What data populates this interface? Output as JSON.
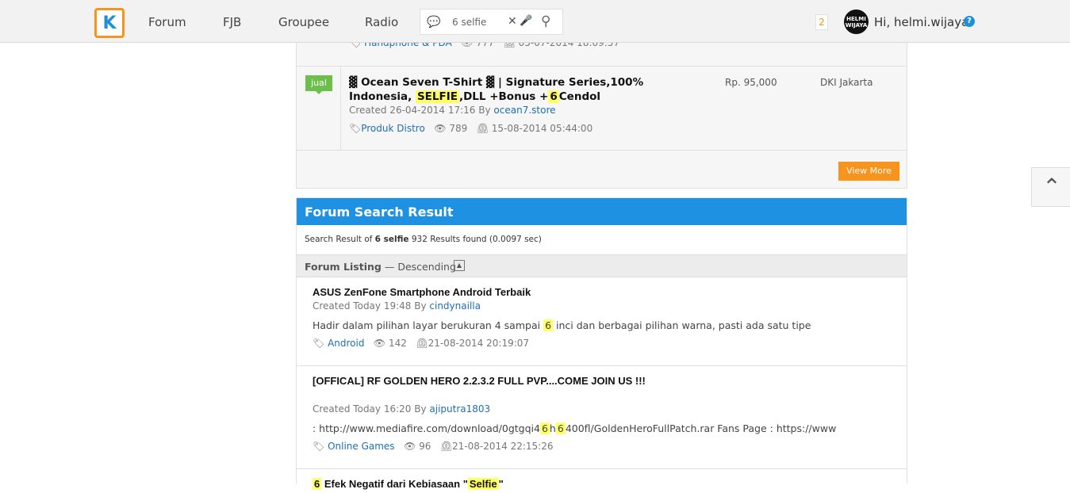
{
  "nav": {
    "logo_text": "K",
    "items": [
      "Forum",
      "FJB",
      "Groupee",
      "Radio"
    ],
    "search_value": "6 selfie",
    "notif_count": "2",
    "avatar_text": "HELMI WIJAYA",
    "greeting": "Hi, helmi.wijaya",
    "help": "?"
  },
  "fjb": {
    "prev_category": "Handphone & PDA",
    "prev_views": "777",
    "prev_date": "05-07-2014 18:09:57",
    "item": {
      "badge": "jual",
      "title_part1": "▓ Ocean Seven T-Shirt ▓ | Signature Series,100% Indonesia,",
      "title_hl1": "SELFIE",
      "title_part2": ",DLL +Bonus +",
      "title_hl2": "6",
      "title_part3": "Cendol",
      "created_prefix": "Created 26-04-2014 17:16 By",
      "author": "ocean7.store",
      "category": "Produk Distro",
      "views": "789",
      "date": "15-08-2014 05:44:00",
      "price": "Rp. 95,000",
      "location": "DKI Jakarta"
    },
    "view_more": "View More"
  },
  "results": {
    "header": "Forum Search Result",
    "summary_prefix": "Search Result of",
    "summary_query": "6 selfie",
    "summary_suffix": "932 Results found (0.0097 sec)",
    "listing_label": "Forum Listing",
    "listing_sort": "— Descending",
    "threads": [
      {
        "title": "ASUS ZenFone Smartphone Android Terbaik",
        "created_prefix": "Created Today 19:48 By",
        "author": "cindynailla",
        "snippet_a": "Hadir dalam pilihan layar berukuran 4 sampai",
        "snippet_hl": "6",
        "snippet_b": "inci dan berbagai pilihan warna, pasti ada satu tipe",
        "category": "Android",
        "views": "142",
        "date": "21-08-2014 20:19:07"
      },
      {
        "title": "[OFFICAL] RF GOLDEN HERO 2.2.3.2 FULL PVP....COME JOIN US !!!",
        "created_prefix": "Created Today 16:20 By",
        "author": "ajiputra1803",
        "snippet_a": ": http://www.mediafire.com/download/0gtgqi4",
        "snippet_hl": "6",
        "snippet_b": "h",
        "snippet_hl2": "6",
        "snippet_c": "400fl/GoldenHeroFullPatch.rar Fans Page : https://www",
        "category": "Online Games",
        "views": "96",
        "date": "21-08-2014 22:15:26"
      },
      {
        "title_hl": "6",
        "title_a": "Efek Negatif dari Kebiasaan \"",
        "title_hl2": "Selfie",
        "title_b": "\""
      }
    ]
  }
}
